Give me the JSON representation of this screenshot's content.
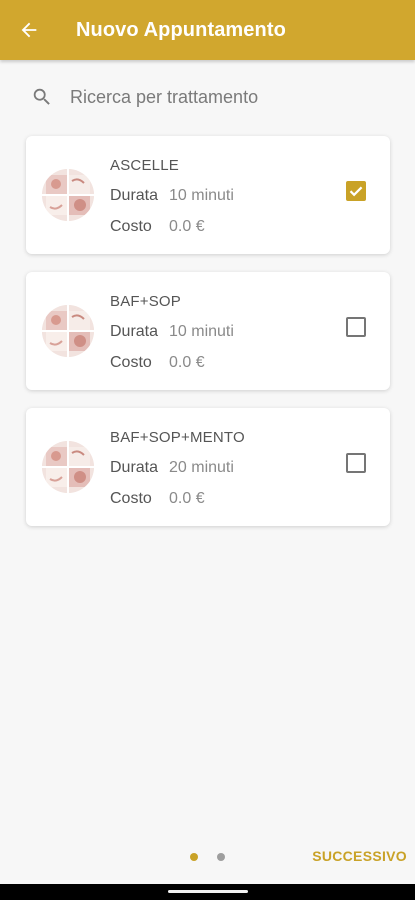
{
  "colors": {
    "accent": "#d1a72e",
    "accent_text": "#c9a227",
    "dot_active": "#c9a227",
    "dot_inactive": "#9e9e9e"
  },
  "appbar": {
    "title": "Nuovo Appuntamento",
    "back_icon": "arrow-back-icon"
  },
  "search": {
    "placeholder": "Ricerca per trattamento",
    "value": "",
    "icon": "search-icon"
  },
  "treatments": [
    {
      "name": "ASCELLE",
      "duration_label": "Durata",
      "duration_value": "10 minuti",
      "cost_label": "Costo",
      "cost_value": "0.0 €",
      "checked": true
    },
    {
      "name": "BAF+SOP",
      "duration_label": "Durata",
      "duration_value": "10 minuti",
      "cost_label": "Costo",
      "cost_value": "0.0 €",
      "checked": false
    },
    {
      "name": "BAF+SOP+MENTO",
      "duration_label": "Durata",
      "duration_value": "20 minuti",
      "cost_label": "Costo",
      "cost_value": "0.0 €",
      "checked": false
    }
  ],
  "footer": {
    "next_label": "SUCCESSIVO",
    "pages": 2,
    "current_page": 1
  }
}
